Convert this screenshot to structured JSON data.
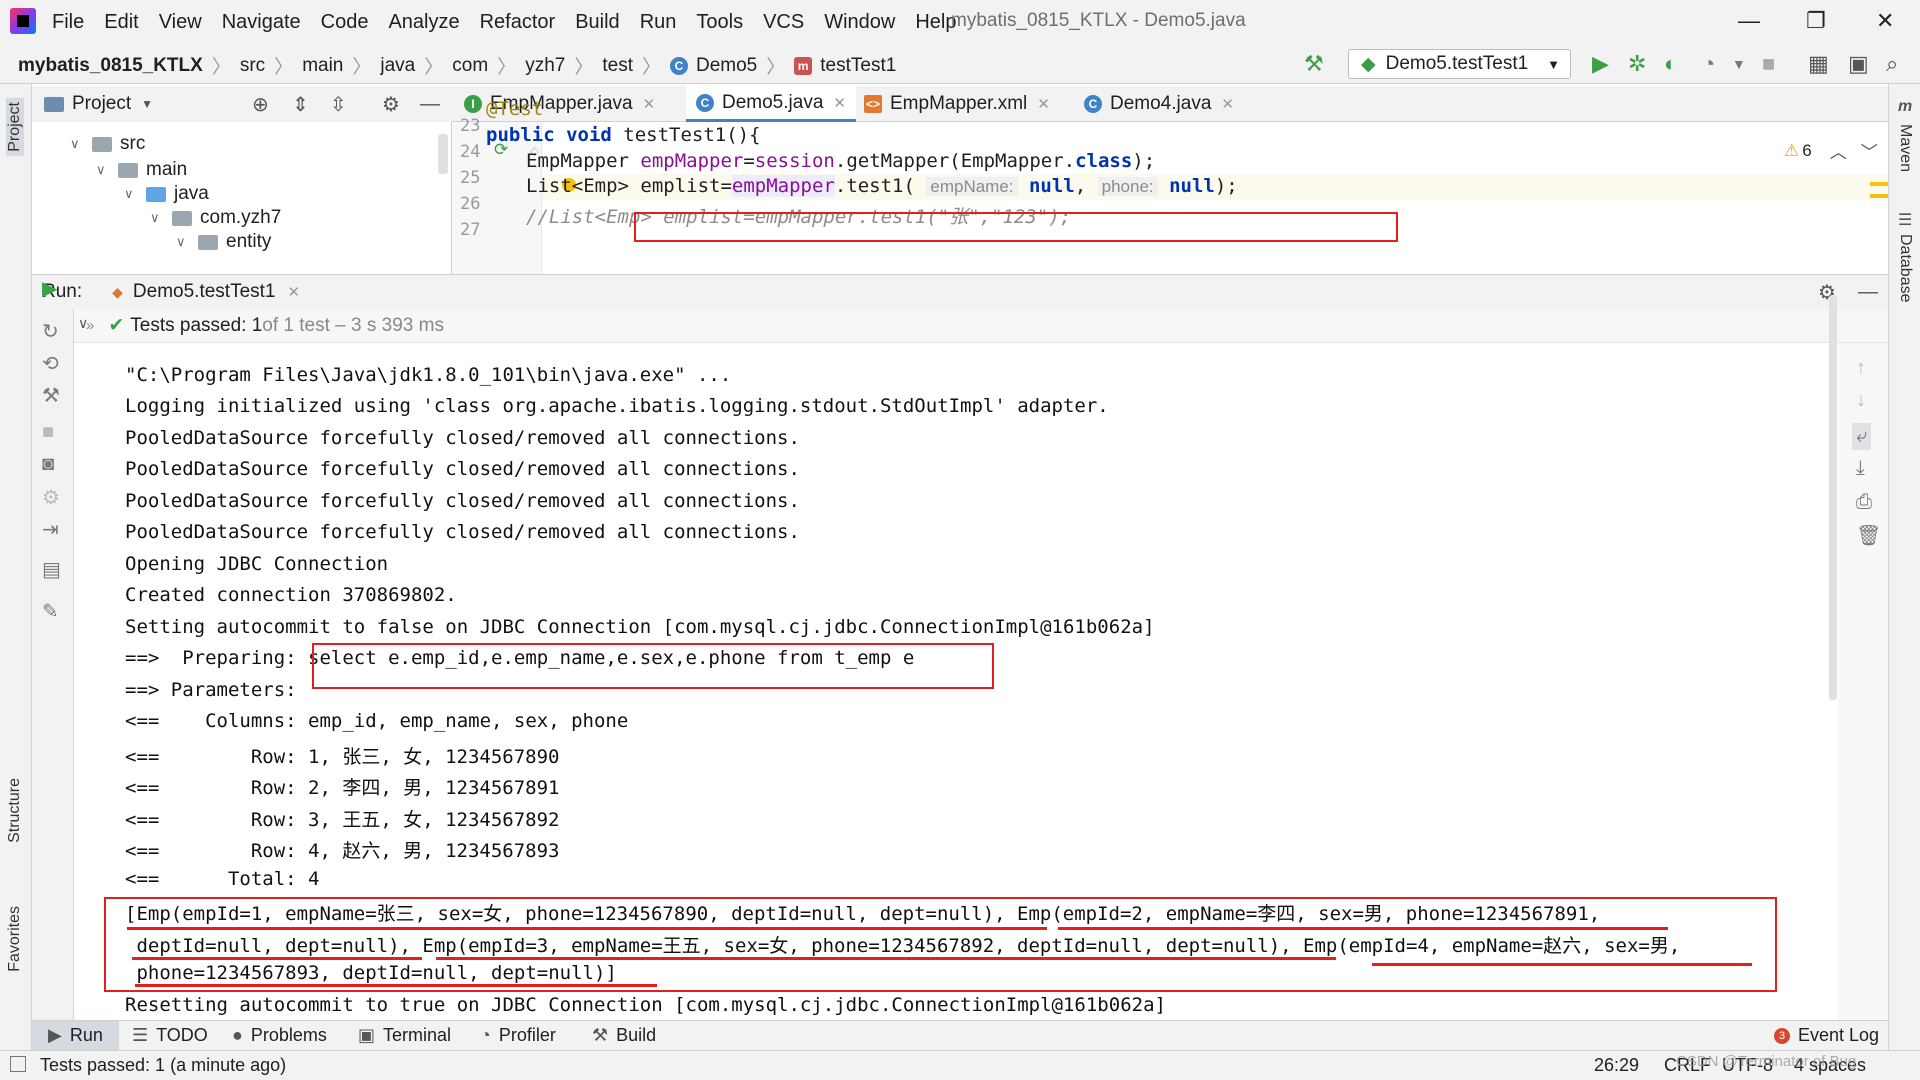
{
  "menubar": {
    "items": [
      "File",
      "Edit",
      "View",
      "Navigate",
      "Code",
      "Analyze",
      "Refactor",
      "Build",
      "Run",
      "Tools",
      "VCS",
      "Window",
      "Help"
    ],
    "title": "mybatis_0815_KTLX - Demo5.java"
  },
  "navbar": {
    "breadcrumbs": [
      "mybatis_0815_KTLX",
      "src",
      "main",
      "java",
      "com",
      "yzh7",
      "test",
      "Demo5",
      "testTest1"
    ],
    "run_config": "Demo5.testTest1"
  },
  "left_strip": {
    "project": "Project",
    "structure": "Structure",
    "favorites": "Favorites"
  },
  "right_strip": {
    "maven": "Maven",
    "database": "Database"
  },
  "project_panel": {
    "title": "Project",
    "tree": [
      {
        "label": "src"
      },
      {
        "label": "main"
      },
      {
        "label": "java"
      },
      {
        "label": "com.yzh7"
      },
      {
        "label": "entity"
      }
    ]
  },
  "editor": {
    "tabs": [
      {
        "label": "EmpMapper.java"
      },
      {
        "label": "Demo5.java"
      },
      {
        "label": "EmpMapper.xml"
      },
      {
        "label": "Demo4.java"
      }
    ],
    "warnings": "6",
    "lines": [
      {
        "num": "23",
        "text": "@Test"
      },
      {
        "num": "24",
        "kw": "public void",
        "rest": " testTest1(){"
      },
      {
        "num": "25",
        "a": "EmpMapper ",
        "b": "empMapper",
        "c": "=",
        "d": "session",
        "e": ".getMapper(EmpMapper.",
        "f": "class",
        "g": ");"
      },
      {
        "num": "26",
        "a": "List<Emp> emplist=",
        "b": "empMapper",
        "c": ".test1( ",
        "h1": "empName:",
        "n1": "null",
        "s": ", ",
        "h2": "phone:",
        "n2": "null",
        "e": ");"
      },
      {
        "num": "27",
        "text": "//List<Emp> emplist=empMapper.test1(\"张\",\"123\");"
      }
    ]
  },
  "run_panel": {
    "label": "Run:",
    "tab": "Demo5.testTest1",
    "status_bold": "Tests passed: 1",
    "status_rest": " of 1 test – 3 s 393 ms",
    "console": [
      "\"C:\\Program Files\\Java\\jdk1.8.0_101\\bin\\java.exe\" ...",
      "Logging initialized using 'class org.apache.ibatis.logging.stdout.StdOutImpl' adapter.",
      "PooledDataSource forcefully closed/removed all connections.",
      "PooledDataSource forcefully closed/removed all connections.",
      "PooledDataSource forcefully closed/removed all connections.",
      "PooledDataSource forcefully closed/removed all connections.",
      "Opening JDBC Connection",
      "Created connection 370869802.",
      "Setting autocommit to false on JDBC Connection [com.mysql.cj.jdbc.ConnectionImpl@161b062a]",
      "==>  Preparing: select e.emp_id,e.emp_name,e.sex,e.phone from t_emp e",
      "==> Parameters: ",
      "<==    Columns: emp_id, emp_name, sex, phone",
      "<==        Row: 1, 张三, 女, 1234567890",
      "<==        Row: 2, 李四, 男, 1234567891",
      "<==        Row: 3, 王五, 女, 1234567892",
      "<==        Row: 4, 赵六, 男, 1234567893",
      "<==      Total: 4",
      "[Emp(empId=1, empName=张三, sex=女, phone=1234567890, deptId=null, dept=null), Emp(empId=2, empName=李四, sex=男, phone=1234567891,",
      " deptId=null, dept=null), Emp(empId=3, empName=王五, sex=女, phone=1234567892, deptId=null, dept=null), Emp(empId=4, empName=赵六, sex=男,",
      " phone=1234567893, deptId=null, dept=null)]",
      "Resetting autocommit to true on JDBC Connection [com.mysql.cj.jdbc.ConnectionImpl@161b062a]"
    ]
  },
  "bottom_tabs": [
    "Run",
    "TODO",
    "Problems",
    "Terminal",
    "Profiler",
    "Build"
  ],
  "event_log": {
    "label": "Event Log",
    "count": "3"
  },
  "statusbar": {
    "message": "Tests passed: 1 (a minute ago)",
    "position": "26:29",
    "line_sep": "CRLF",
    "encoding": "UTF-8",
    "indent": "4 spaces",
    "watermark": "CSDN @Terminator of Bug"
  },
  "colors": {
    "accent": "#4083c9",
    "highlight_red": "#e02020",
    "pass_green": "#3d9e48"
  }
}
